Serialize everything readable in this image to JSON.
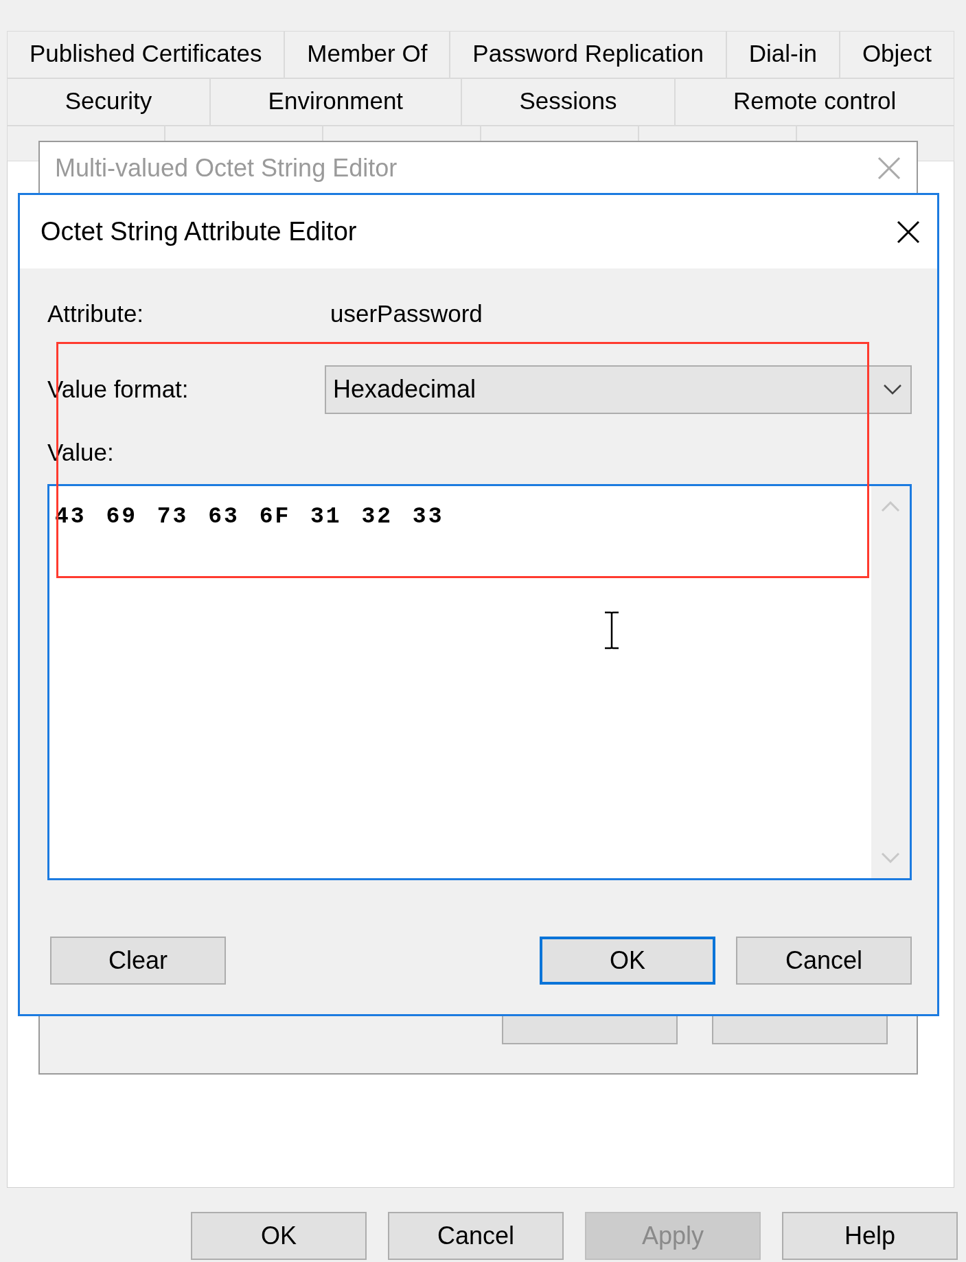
{
  "property_sheet": {
    "tab_rows": [
      [
        {
          "label": "Published Certificates",
          "selected": false
        },
        {
          "label": "Member Of",
          "selected": false
        },
        {
          "label": "Password Replication",
          "selected": false
        },
        {
          "label": "Dial-in",
          "selected": false
        },
        {
          "label": "Object",
          "selected": false
        }
      ],
      [
        {
          "label": "Security",
          "selected": false
        },
        {
          "label": "Environment",
          "selected": false
        },
        {
          "label": "Sessions",
          "selected": false
        },
        {
          "label": "Remote control",
          "selected": false
        }
      ]
    ],
    "buttons": [
      {
        "label": "OK",
        "disabled": false
      },
      {
        "label": "Cancel",
        "disabled": false
      },
      {
        "label": "Apply",
        "disabled": true
      },
      {
        "label": "Help",
        "disabled": false
      }
    ]
  },
  "multi_valued_dialog": {
    "title": "Multi-valued Octet String Editor"
  },
  "octet_dialog": {
    "title": "Octet String Attribute Editor",
    "attribute_label": "Attribute:",
    "attribute_value": "userPassword",
    "format_label": "Value format:",
    "format_value": "Hexadecimal",
    "value_label": "Value:",
    "value": "43 69 73 63 6F 31 32 33",
    "buttons": [
      {
        "label": "Clear",
        "default": false
      },
      {
        "label": "OK",
        "default": true
      },
      {
        "label": "Cancel",
        "default": false
      }
    ]
  }
}
